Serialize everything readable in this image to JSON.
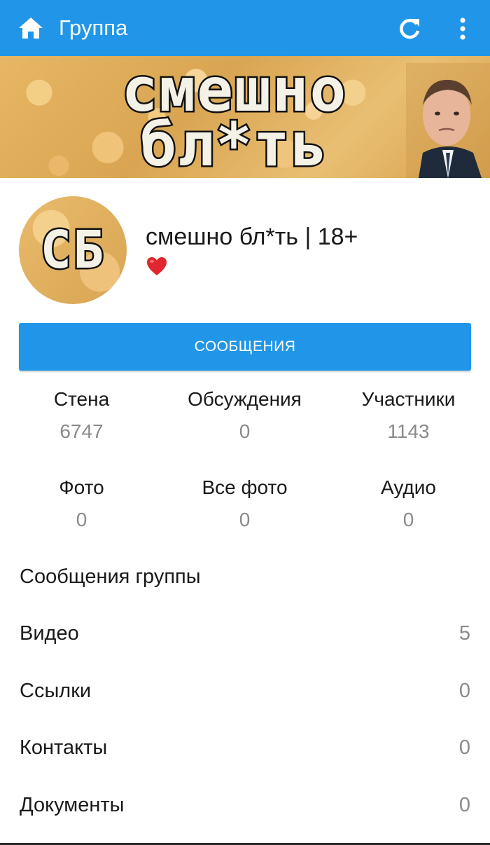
{
  "appbar": {
    "title": "Группа",
    "home_icon": "home-icon",
    "refresh_icon": "refresh-icon",
    "more_icon": "more-vert-icon",
    "color": "#2196e8"
  },
  "cover": {
    "line1": "смешно",
    "line2": "бл*ть"
  },
  "group": {
    "avatar_text": "СБ",
    "name": "смешно бл*ть | 18+",
    "status_icon": "heart-icon"
  },
  "messages_button": {
    "label": "СООБЩЕНИЯ"
  },
  "stats": [
    {
      "label": "Стена",
      "value": "6747"
    },
    {
      "label": "Обсуждения",
      "value": "0"
    },
    {
      "label": "Участники",
      "value": "1143"
    },
    {
      "label": "Фото",
      "value": "0"
    },
    {
      "label": "Все фото",
      "value": "0"
    },
    {
      "label": "Аудио",
      "value": "0"
    }
  ],
  "list": [
    {
      "label": "Сообщения группы",
      "count": ""
    },
    {
      "label": "Видео",
      "count": "5"
    },
    {
      "label": "Ссылки",
      "count": "0"
    },
    {
      "label": "Контакты",
      "count": "0"
    },
    {
      "label": "Документы",
      "count": "0"
    }
  ]
}
